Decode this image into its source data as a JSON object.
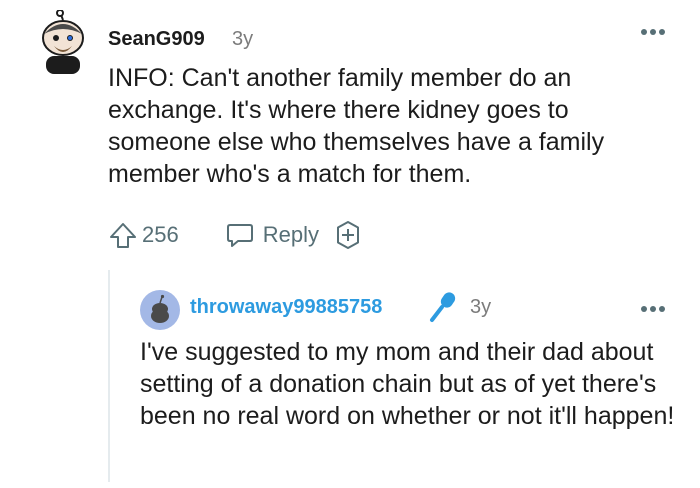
{
  "comment": {
    "username": "SeanG909",
    "age": "3y",
    "text": "INFO: Can't another family member do an exchange. It's where there kidney goes to someone else who themselves have a family member who's a match for them.",
    "votes": "256",
    "reply_label": "Reply",
    "icons": {
      "avatar": "snoo-avatar-icon",
      "more": "more-options-icon",
      "upvote": "upvote-arrow-icon",
      "reply": "reply-speech-bubble-icon",
      "award": "award-plus-icon"
    }
  },
  "reply": {
    "username": "throwaway99885758",
    "age": "3y",
    "text": "I've suggested to my mom and their dad about setting of a donation chain but as of yet there's been no real word on whether or not it'll happen!",
    "icons": {
      "avatar": "default-avatar-icon",
      "flair": "microphone-icon",
      "more": "more-options-icon"
    }
  },
  "colors": {
    "username_link": "#2d9be0",
    "meta_gray": "#7c7c7c",
    "action_gray": "#576f76",
    "thread_line": "#e5ebee"
  }
}
